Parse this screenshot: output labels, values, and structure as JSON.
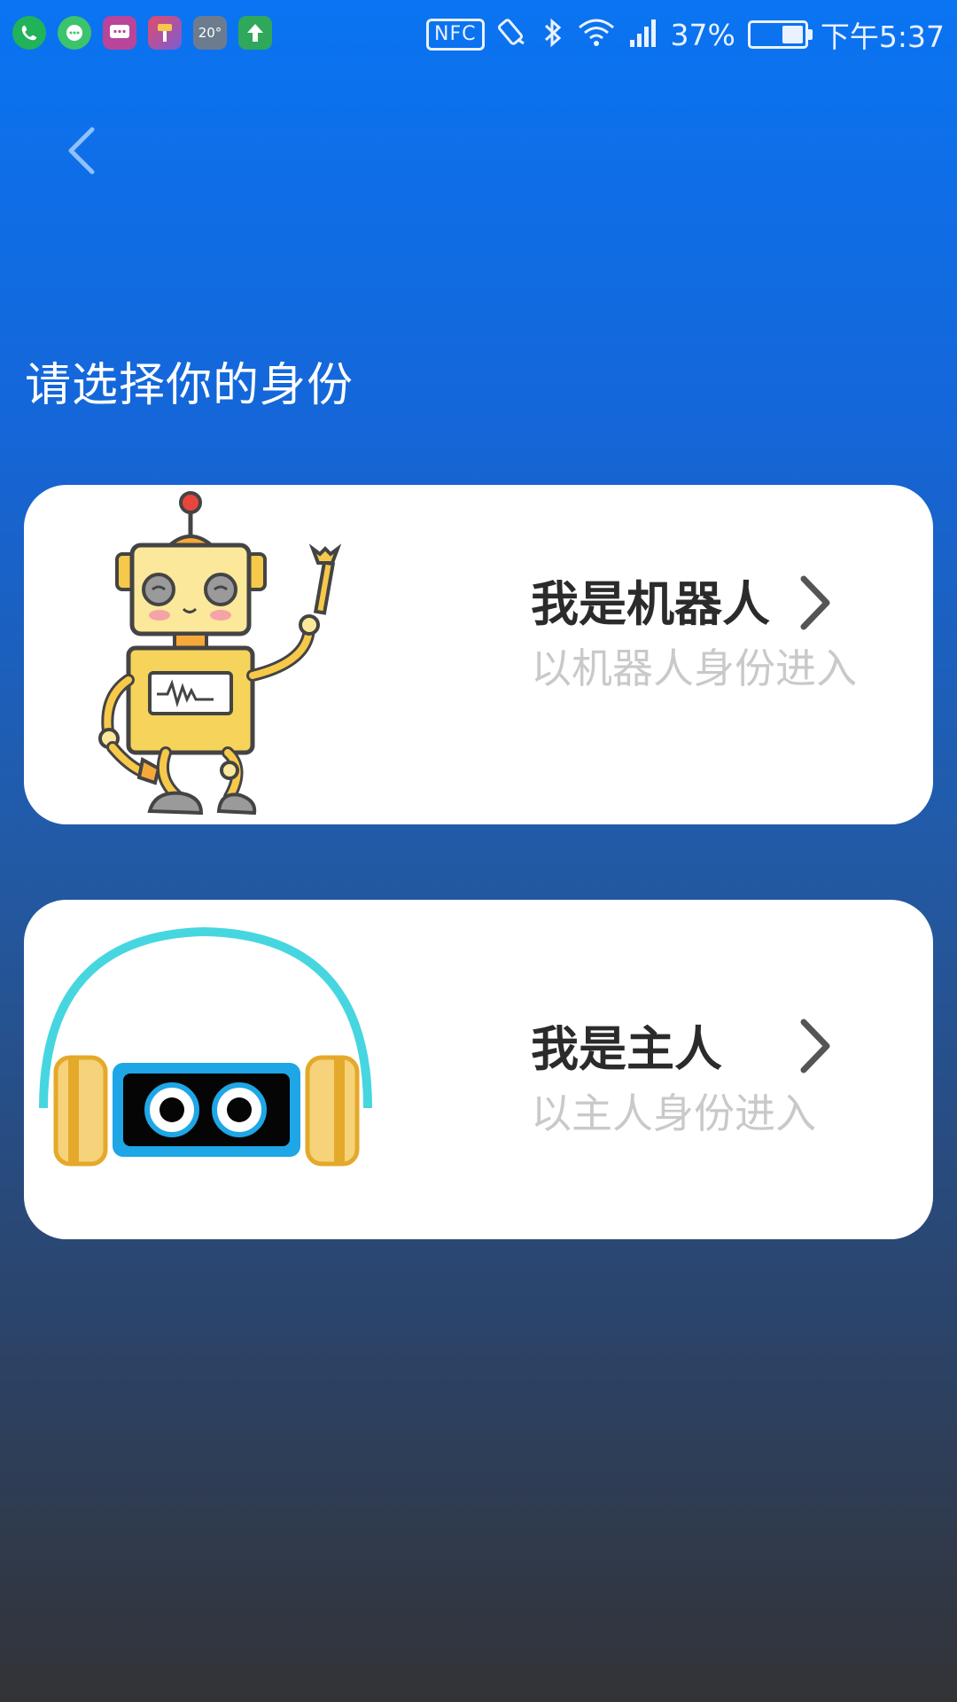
{
  "status_bar": {
    "nfc_label": "NFC",
    "battery_percent": "37%",
    "battery_level": 0.37,
    "time": "下午5:37",
    "notification_icons": [
      "phone-icon",
      "message-bubble-icon",
      "sms-icon",
      "app-icon",
      "weather-icon",
      "upload-icon"
    ],
    "weather_temp": "20°"
  },
  "nav": {
    "back_icon": "chevron-left-icon"
  },
  "page": {
    "title": "请选择你的身份"
  },
  "options": [
    {
      "title": "我是机器人",
      "subtitle": "以机器人身份进入",
      "illustration": "robot-illustration"
    },
    {
      "title": "我是主人",
      "subtitle": "以主人身份进入",
      "illustration": "headphone-robot-illustration"
    }
  ],
  "colors": {
    "gradient_top": "#0a74f2",
    "gradient_bottom": "#333336",
    "card_bg": "#ffffff",
    "title_text": "#2b2b2b",
    "subtitle_text": "#c9c9c9"
  }
}
